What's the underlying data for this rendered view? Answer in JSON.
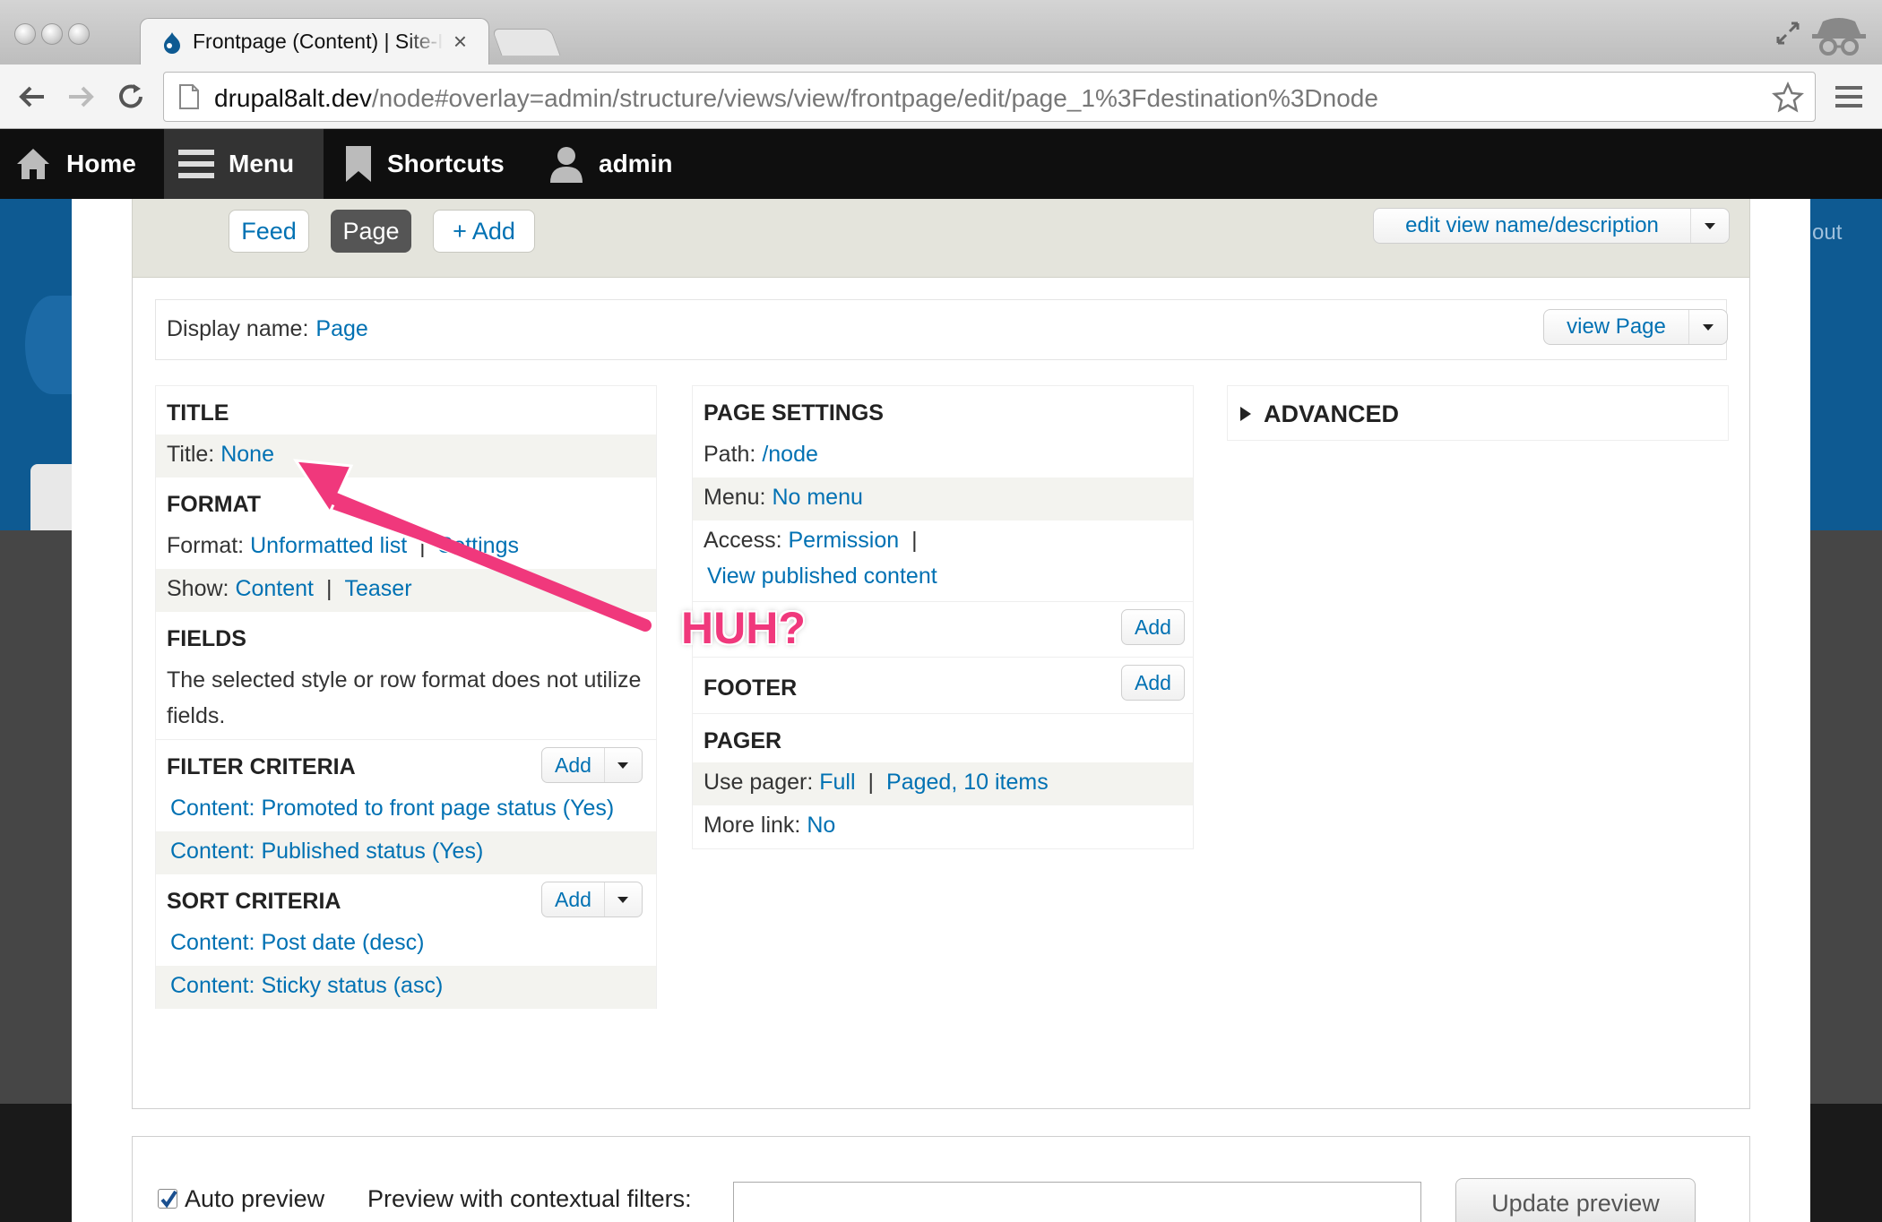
{
  "browser": {
    "tab_title": "Frontpage (Content) | Site-Install",
    "tab_close": "×",
    "url_host": "drupal8alt.dev",
    "url_path": "/node#overlay=admin/structure/views/view/frontpage/edit/page_1%3Fdestination%3Dnode"
  },
  "admin_bar": {
    "home": "Home",
    "menu": "Menu",
    "shortcuts": "Shortcuts",
    "user": "admin"
  },
  "site_background": {
    "logout_fragment": "out"
  },
  "display_tabs": {
    "feed": "Feed",
    "page": "Page",
    "add": "+ Add",
    "edit_view": "edit view name/description"
  },
  "display_name": {
    "label": "Display name:",
    "value": "Page",
    "view_button": "view Page"
  },
  "col1": {
    "title_head": "TITLE",
    "title_label": "Title:",
    "title_value": "None",
    "format_head": "FORMAT",
    "format_label": "Format:",
    "format_value": "Unformatted list",
    "format_settings": "Settings",
    "show_label": "Show:",
    "show_value": "Content",
    "show_teaser": "Teaser",
    "fields_head": "FIELDS",
    "fields_note": "The selected style or row format does not utilize fields.",
    "filter_head": "FILTER CRITERIA",
    "filter_add": "Add",
    "filter_items": [
      "Content: Promoted to front page status (Yes)",
      "Content: Published status (Yes)"
    ],
    "sort_head": "SORT CRITERIA",
    "sort_add": "Add",
    "sort_items": [
      "Content: Post date (desc)",
      "Content: Sticky status (asc)"
    ]
  },
  "col2": {
    "page_settings_head": "PAGE SETTINGS",
    "path_label": "Path:",
    "path_value": "/node",
    "menu_label": "Menu:",
    "menu_value": "No menu",
    "access_label": "Access:",
    "access_value": "Permission",
    "access_perm": "View published content",
    "header_add": "Add",
    "footer_head": "FOOTER",
    "footer_add": "Add",
    "pager_head": "PAGER",
    "pager_label": "Use pager:",
    "pager_value": "Full",
    "pager_items": "Paged, 10 items",
    "more_label": "More link:",
    "more_value": "No"
  },
  "col3": {
    "advanced_head": "ADVANCED"
  },
  "preview": {
    "auto_preview": "Auto preview",
    "auto_preview_checked": true,
    "ctx_label": "Preview with contextual filters:",
    "ctx_value": "",
    "update_button": "Update preview"
  },
  "annotation": {
    "text": "HUH?",
    "color": "#f0387c"
  },
  "colors": {
    "link": "#0071b3",
    "toolbar": "#0f0f0f",
    "site_blue": "#0e5a92"
  }
}
